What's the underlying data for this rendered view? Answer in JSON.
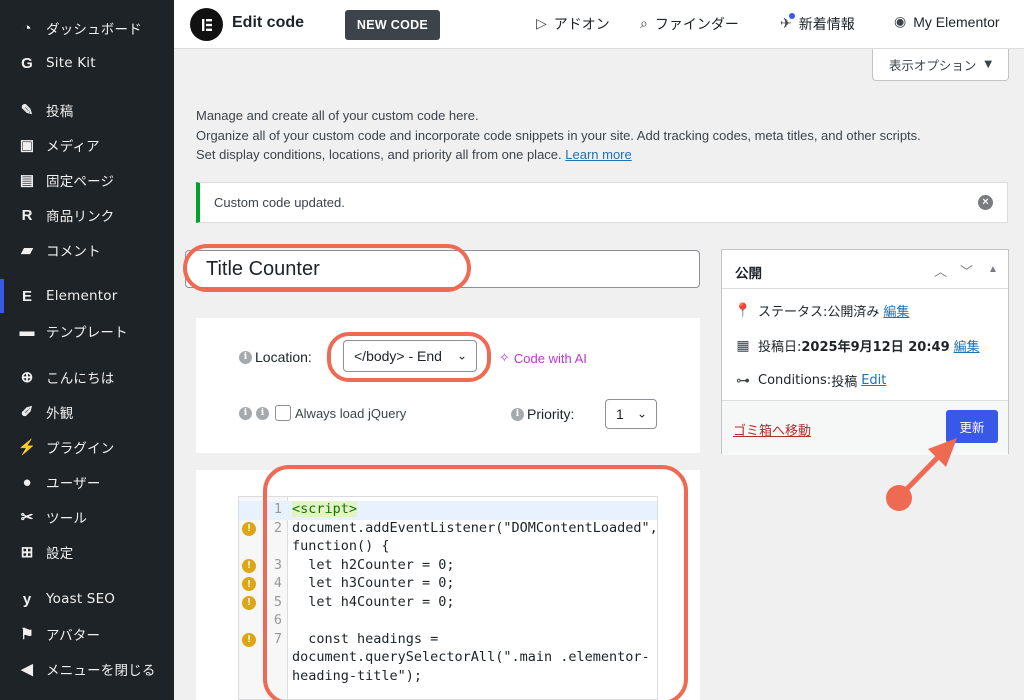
{
  "sidebar": {
    "items": [
      {
        "label": "ダッシュボード",
        "icon": "dashboard-icon",
        "glyph": "◔"
      },
      {
        "label": "Site Kit",
        "icon": "site-kit-icon",
        "glyph": "G"
      },
      {
        "label": "投稿",
        "icon": "pin-icon",
        "glyph": "✎"
      },
      {
        "label": "メディア",
        "icon": "media-icon",
        "glyph": "▣"
      },
      {
        "label": "固定ページ",
        "icon": "page-icon",
        "glyph": "▤"
      },
      {
        "label": "商品リンク",
        "icon": "product-link-icon",
        "glyph": "R"
      },
      {
        "label": "コメント",
        "icon": "comment-icon",
        "glyph": "▰"
      },
      {
        "label": "Elementor",
        "icon": "elementor-icon",
        "glyph": "E"
      },
      {
        "label": "テンプレート",
        "icon": "folder-icon",
        "glyph": "▬"
      },
      {
        "label": "こんにちは",
        "icon": "plus-circle-icon",
        "glyph": "⊕"
      },
      {
        "label": "外観",
        "icon": "brush-icon",
        "glyph": "✐"
      },
      {
        "label": "プラグイン",
        "icon": "plugin-icon",
        "glyph": "⚡"
      },
      {
        "label": "ユーザー",
        "icon": "user-icon",
        "glyph": "●"
      },
      {
        "label": "ツール",
        "icon": "wrench-icon",
        "glyph": "✂"
      },
      {
        "label": "設定",
        "icon": "settings-icon",
        "glyph": "⊞"
      },
      {
        "label": "Yoast SEO",
        "icon": "yoast-icon",
        "glyph": "y"
      },
      {
        "label": "アバター",
        "icon": "avatar-icon",
        "glyph": "⚑"
      },
      {
        "label": "メニューを閉じる",
        "icon": "collapse-icon",
        "glyph": "◀"
      }
    ]
  },
  "topbar": {
    "title": "Edit code",
    "new_code": "NEW CODE",
    "addons": "アドオン",
    "finder": "ファインダー",
    "news": "新着情報",
    "my_elementor": "My Elementor"
  },
  "screen_options": "表示オプション",
  "intro": {
    "line1": "Manage and create all of your custom code here.",
    "line2": "Organize all of your custom code and incorporate code snippets in your site. Add tracking codes, meta titles, and other scripts.",
    "line3": "Set display conditions, locations, and priority all from one place.",
    "learn_more": "Learn more"
  },
  "notice": "Custom code updated.",
  "title_value": "Title Counter",
  "location": {
    "label": "Location:",
    "value": "</body> - End",
    "ai_link": "Code with AI",
    "jquery": "Always load jQuery",
    "priority_label": "Priority:",
    "priority_value": "1"
  },
  "code": {
    "lines": [
      {
        "n": "1",
        "text": "<script>"
      },
      {
        "n": "2",
        "text": "document.addEventListener(\"DOMContentLoaded\","
      },
      {
        "n": "",
        "text": "function() {"
      },
      {
        "n": "3",
        "text": "  let h2Counter = 0;"
      },
      {
        "n": "4",
        "text": "  let h3Counter = 0;"
      },
      {
        "n": "5",
        "text": "  let h4Counter = 0;"
      },
      {
        "n": "6",
        "text": ""
      },
      {
        "n": "7",
        "text": "  const headings ="
      },
      {
        "n": "",
        "text": "document.querySelectorAll(\".main .elementor-"
      },
      {
        "n": "",
        "text": "heading-title\");"
      }
    ]
  },
  "publish": {
    "title": "公開",
    "status_label": "ステータス: ",
    "status_value": "公開済み",
    "date_label": "投稿日: ",
    "date_value": "2025年9月12日 20:49",
    "conditions_label": "Conditions: ",
    "conditions_value": "投稿",
    "edit_jp": "編集",
    "edit_en": "Edit",
    "trash": "ゴミ箱へ移動",
    "update": "更新"
  },
  "colors": {
    "accent": "#3858e9",
    "annotation": "#ee6a52",
    "success": "#00a32a",
    "ai": "#c036d6"
  }
}
